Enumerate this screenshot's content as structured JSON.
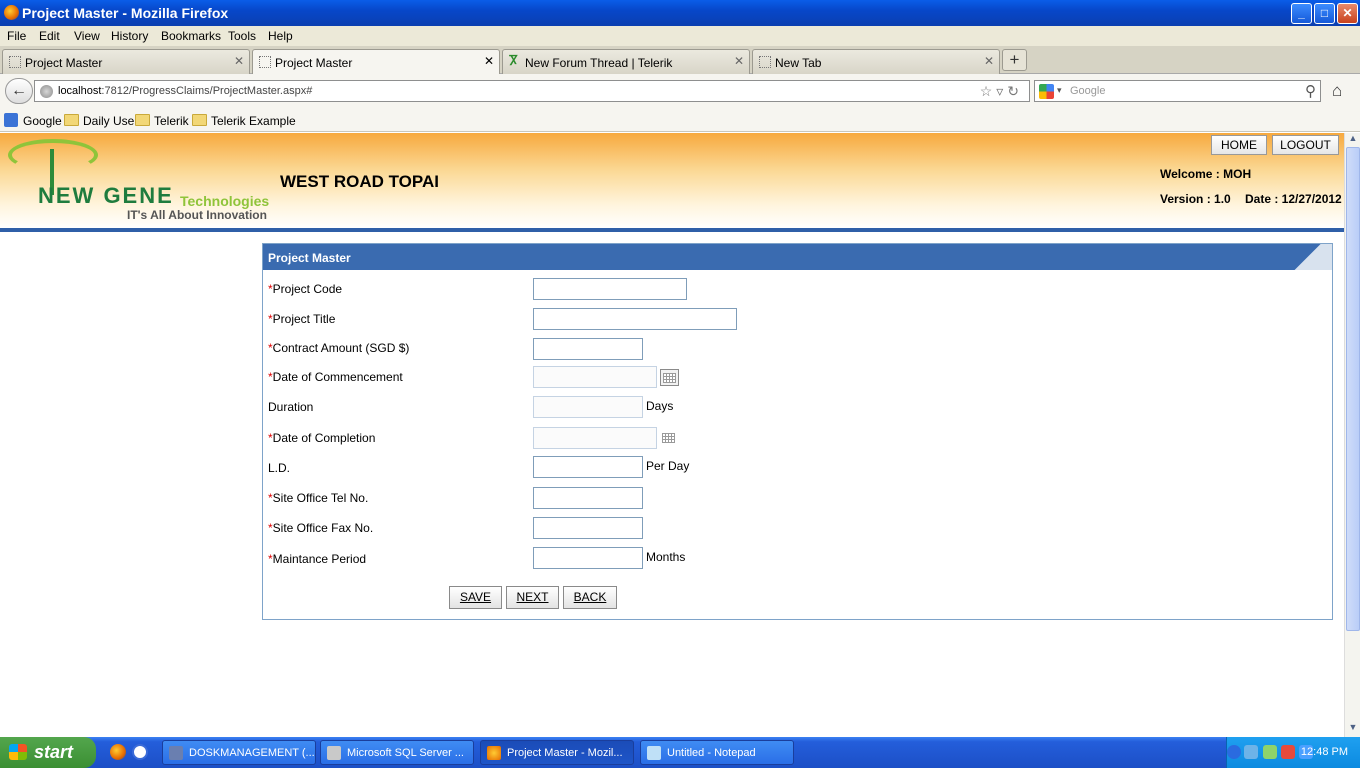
{
  "window": {
    "title": "Project Master - Mozilla Firefox",
    "min": "_",
    "max": "□",
    "close": "✕"
  },
  "menu": [
    "File",
    "Edit",
    "View",
    "History",
    "Bookmarks",
    "Tools",
    "Help"
  ],
  "tabs": [
    {
      "label": "Project Master",
      "close": "✕"
    },
    {
      "label": "Project Master",
      "close": "✕"
    },
    {
      "label": "New Forum Thread | Telerik",
      "close": "✕"
    },
    {
      "label": "New Tab",
      "close": "✕"
    }
  ],
  "new_tab": "+",
  "nav": {
    "back": "←",
    "url_host": "localhost",
    "url_rest": ":7812/ProgressClaims/ProjectMaster.aspx#",
    "url_icons": "☆▿↻",
    "search_placeholder": "Google",
    "search_icon": "⚲",
    "home": "⌂"
  },
  "bookmarks": [
    "Google",
    "Daily Use",
    "Telerik",
    "Telerik Example"
  ],
  "header": {
    "brand": "NEW GENE",
    "brand_suffix": "Technologies",
    "tagline": "IT's All About Innovation",
    "company": "WEST ROAD TOPAI",
    "home_btn": "HOME",
    "logout_btn": "LOGOUT",
    "welcome": "Welcome : MOH",
    "version": "Version : 1.0",
    "date": "Date : 12/27/2012"
  },
  "form": {
    "title": "Project Master",
    "required_mark": "*",
    "fields": [
      {
        "label": "Project Code",
        "required": true,
        "value": ""
      },
      {
        "label": "Project Title",
        "required": true,
        "value": ""
      },
      {
        "label": "Contract Amount (SGD $)",
        "required": true,
        "value": ""
      },
      {
        "label": "Date of Commencement",
        "required": true,
        "value": ""
      },
      {
        "label": "Duration",
        "required": false,
        "value": "",
        "suffix": "Days"
      },
      {
        "label": "Date of Completion",
        "required": true,
        "value": ""
      },
      {
        "label": "L.D.",
        "required": false,
        "value": "",
        "suffix": "Per Day"
      },
      {
        "label": "Site Office Tel No.",
        "required": true,
        "value": ""
      },
      {
        "label": "Site Office Fax No.",
        "required": true,
        "value": ""
      },
      {
        "label": "Maintance Period",
        "required": true,
        "value": "",
        "suffix": "Months"
      }
    ],
    "buttons": {
      "save": "SAVE",
      "next": "NEXT",
      "back": "BACK"
    }
  },
  "scrollbar": {
    "up": "▲",
    "down": "▼"
  },
  "taskbar": {
    "start": "start",
    "tasks": [
      "DOSKMANAGEMENT (...",
      "Microsoft SQL Server ...",
      "Project Master - Mozil...",
      "Untitled - Notepad"
    ],
    "clock": "12:48 PM"
  }
}
